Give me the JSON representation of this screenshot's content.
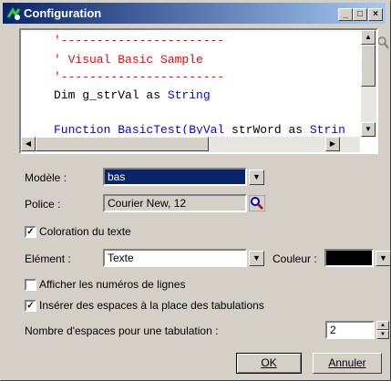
{
  "window": {
    "title": "Configuration"
  },
  "titlebar_buttons": {
    "minimize": "_",
    "maximize": "□",
    "close": "×"
  },
  "code_lines": [
    {
      "text": "'-----------------------",
      "color": "#ff0000"
    },
    {
      "text": "' Visual Basic Sample",
      "color": "#ff0000"
    },
    {
      "text": "'-----------------------",
      "color": "#ff0000"
    },
    {
      "text": "Dim g_strVal as ",
      "color": "#000000",
      "keyword": "String"
    },
    {
      "text": "",
      "color": "#000000"
    },
    {
      "text": "Function BasicTest(ByVal",
      "color": "#0000ff",
      "rest": " strWord as ",
      "keyword": "Strin"
    }
  ],
  "form": {
    "modele": {
      "label": "Modèle :",
      "value": "bas"
    },
    "police": {
      "label": "Police :",
      "value": "Courier New, 12"
    },
    "coloration": {
      "label": "Coloration du texte",
      "checked": true
    },
    "element": {
      "label": "Elément :",
      "value": "Texte"
    },
    "couleur": {
      "label": "Couleur :",
      "value_color": "#000000"
    },
    "numeros": {
      "label": "Afficher les numéros de lignes",
      "checked": false
    },
    "espaces": {
      "label": "Insérer des espaces à la place des tabulations",
      "checked": true
    },
    "nombre": {
      "label": "Nombre d'espaces pour une tabulation :",
      "value": "2"
    }
  },
  "buttons": {
    "ok": "OK",
    "cancel": "Annuler"
  },
  "colors": {
    "accent": "#0a246a",
    "keyword": "#0000ff",
    "comment": "#ff0000",
    "face": "#d4d0c8"
  }
}
